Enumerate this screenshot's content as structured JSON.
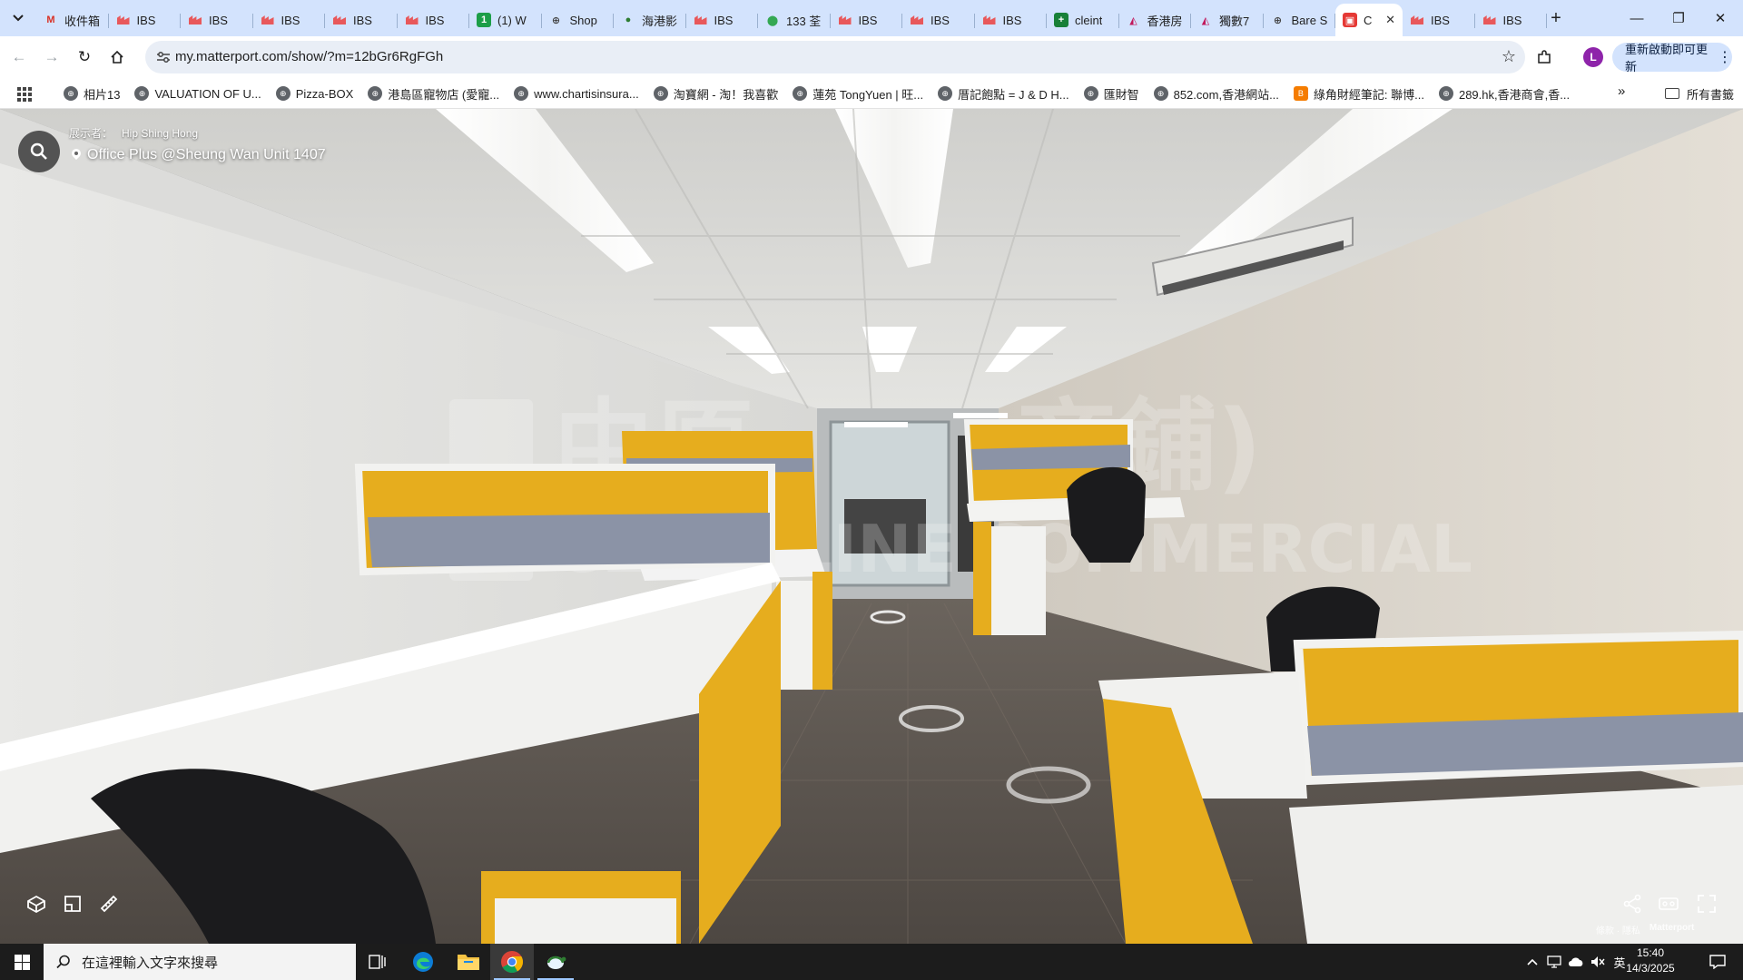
{
  "window": {
    "minimize_glyph": "—",
    "restore_glyph": "❐",
    "close_glyph": "✕"
  },
  "tabs": [
    {
      "label": "收件箱",
      "icon": "gmail-icon"
    },
    {
      "label": "IBS",
      "icon": "ibs-icon"
    },
    {
      "label": "IBS",
      "icon": "ibs-icon"
    },
    {
      "label": "IBS",
      "icon": "ibs-icon"
    },
    {
      "label": "IBS",
      "icon": "ibs-icon"
    },
    {
      "label": "IBS",
      "icon": "ibs-icon"
    },
    {
      "label": "(1) W",
      "icon": "whatsapp-icon"
    },
    {
      "label": "Shop",
      "icon": "globe-icon"
    },
    {
      "label": "海港影",
      "icon": "turtle-icon"
    },
    {
      "label": "IBS",
      "icon": "ibs-icon"
    },
    {
      "label": "133 荃",
      "icon": "maps-icon"
    },
    {
      "label": "IBS",
      "icon": "ibs-icon"
    },
    {
      "label": "IBS",
      "icon": "ibs-icon"
    },
    {
      "label": "IBS",
      "icon": "ibs-icon"
    },
    {
      "label": "cleint",
      "icon": "sheets-icon"
    },
    {
      "label": "香港房",
      "icon": "chart-icon"
    },
    {
      "label": "獨數7",
      "icon": "chart-icon"
    },
    {
      "label": "Bare S",
      "icon": "globe-icon"
    },
    {
      "label": "C",
      "icon": "matterport-icon",
      "active": true
    },
    {
      "label": "IBS",
      "icon": "ibs-icon"
    },
    {
      "label": "IBS",
      "icon": "ibs-icon"
    }
  ],
  "toolbar": {
    "url": "my.matterport.com/show/?m=12bGr6RgFGh",
    "update_button": "重新啟動即可更新",
    "avatar_letter": "L"
  },
  "bookmarks": {
    "items": [
      {
        "label": "相片13",
        "icon": "globe-icon"
      },
      {
        "label": "VALUATION OF U...",
        "icon": "globe-icon"
      },
      {
        "label": "Pizza-BOX",
        "icon": "globe-icon"
      },
      {
        "label": "港島區寵物店 (愛寵...",
        "icon": "globe-icon"
      },
      {
        "label": "www.chartisinsura...",
        "icon": "globe-icon"
      },
      {
        "label": "淘寶網 - 淘！我喜歡",
        "icon": "globe-icon"
      },
      {
        "label": "蓮苑 TongYuen | 旺...",
        "icon": "globe-icon"
      },
      {
        "label": "厝記飽點 = J & D H...",
        "icon": "globe-icon"
      },
      {
        "label": "匯財智",
        "icon": "globe-icon"
      },
      {
        "label": "852.com,香港網站...",
        "icon": "globe-icon"
      },
      {
        "label": "綠角財經筆記: 聯博...",
        "icon": "blogger-icon"
      },
      {
        "label": "289.hk,香港商會,香...",
        "icon": "globe-icon"
      }
    ],
    "more_glyph": "»",
    "all_bookmarks": "所有書籤"
  },
  "viewer": {
    "presenter_prefix": "展示者：",
    "presenter_name": "Hip Shing Hong",
    "space_title": "Office Plus @Sheung Wan Unit 1407",
    "credit_text": "條款 · 隱私",
    "brand": "Matterport",
    "colors": {
      "desk_yellow": "#e6ad1e",
      "panel_grey": "#8b93a6",
      "carpet": "#5d5650",
      "ceiling": "#d9d9d6"
    }
  },
  "taskbar": {
    "search_placeholder": "在這裡輸入文字來搜尋",
    "ime": "英",
    "time": "15:40",
    "date": "14/3/2025"
  }
}
